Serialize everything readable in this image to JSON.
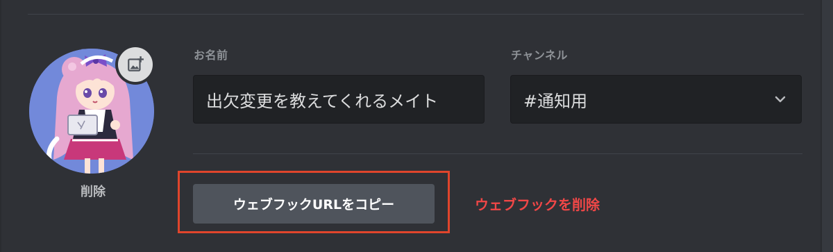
{
  "avatar": {
    "remove_label": "削除",
    "image": "anime-maid-girl-avatar",
    "upload_icon": "image-plus-icon"
  },
  "form": {
    "name_label": "お名前",
    "name_value": "出欠変更を教えてくれるメイト",
    "channel_label": "チャンネル",
    "channel_value": "#通知用",
    "channel_icon": "chevron-down-icon"
  },
  "actions": {
    "copy_url_label": "ウェブフックURLをコピー",
    "delete_label": "ウェブフックを削除"
  },
  "colors": {
    "background": "#2f3136",
    "input_background": "#202225",
    "button": "#4f545c",
    "danger": "#f04747",
    "highlight": "#e0452c",
    "avatar_background": "#7289da"
  }
}
